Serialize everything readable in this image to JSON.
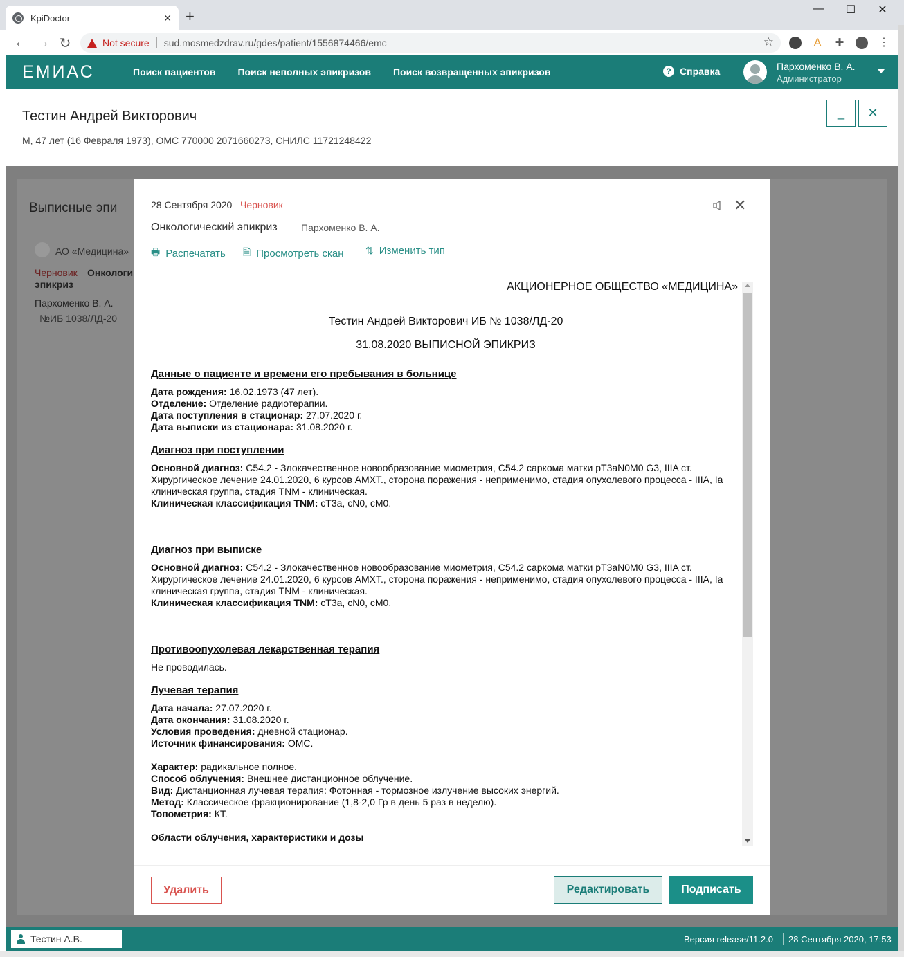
{
  "browser": {
    "tab_title": "KpiDoctor",
    "security_label": "Not secure",
    "url": "sud.mosmedzdrav.ru/gdes/patient/1556874466/emc"
  },
  "app": {
    "logo": "ЕМИАС",
    "nav": [
      "Поиск пациентов",
      "Поиск неполных эпикризов",
      "Поиск возвращенных эпикризов"
    ],
    "help_label": "Справка",
    "user_name": "Пархоменко В. А.",
    "user_role": "Администратор"
  },
  "patient": {
    "name": "Тестин Андрей Викторович",
    "info": "М, 47 лет (16 Февраля 1973), ОМС 770000 2071660273, СНИЛС 11721248422",
    "minimize_label": "_",
    "close_label": "✕"
  },
  "background": {
    "title": "Выписные эпи",
    "org": "АО «Медицина»",
    "draft": "Черновик",
    "doctype_a": "Онкологи",
    "doctype_b": "эпикриз",
    "doctor": "Пархоменко В. А.",
    "ib": "№ИБ 1038/ЛД-20"
  },
  "modal": {
    "date": "28 Сентября 2020",
    "status": "Черновик",
    "type": "Онкологический эпикриз",
    "author": "Пархоменко В. А.",
    "actions": {
      "print": "Распечатать",
      "scan": "Просмотреть скан",
      "change": "Изменить тип"
    },
    "buttons": {
      "delete": "Удалить",
      "edit": "Редактировать",
      "sign": "Подписать"
    }
  },
  "document": {
    "org": "АКЦИОНЕРНОЕ ОБЩЕСТВО «МЕДИЦИНА»",
    "patient_line": "Тестин Андрей Викторович ИБ № 1038/ЛД-20",
    "doc_title": "31.08.2020 ВЫПИСНОЙ ЭПИКРИЗ",
    "s1": {
      "heading": "Данные о пациенте и времени его пребывания в больнице",
      "birth_label": "Дата рождения:",
      "birth": " 16.02.1973 (47 лет).",
      "dept_label": "Отделение:",
      "dept": " Отделение радиотерапии.",
      "in_label": "Дата поступления в стационар:",
      "in": " 27.07.2020 г.",
      "out_label": "Дата выписки из стационара:",
      "out": " 31.08.2020 г."
    },
    "s2": {
      "heading": "Диагноз при поступлении",
      "main_label": "Основной диагноз:",
      "main": " С54.2 - Злокачественное новообразование миометрия, С54.2 саркома матки pT3aN0M0 G3, IIIA ст. Хирургическое лечение 24.01.2020, 6 курсов АМХТ., сторона поражения - неприменимо, стадия опухолевого процесса - IIIA, Ia клиническая группа, стадия TNM - клиническая.",
      "tnm_label": "Клиническая классификация TNM:",
      "tnm": " cT3a, cN0, cM0."
    },
    "s3": {
      "heading": "Диагноз при выписке",
      "main_label": "Основной диагноз:",
      "main": " С54.2 - Злокачественное новообразование миометрия, С54.2 саркома матки pT3aN0M0 G3, IIIA ст. Хирургическое лечение 24.01.2020, 6 курсов АМХТ., сторона поражения - неприменимо, стадия опухолевого процесса - IIIA, Ia клиническая группа, стадия TNM - клиническая.",
      "tnm_label": "Клиническая классификация TNM:",
      "tnm": " cT3a, cN0, cM0."
    },
    "s4": {
      "heading": "Противоопухолевая лекарственная терапия",
      "text": "Не проводилась."
    },
    "s5": {
      "heading": "Лучевая терапия",
      "start_label": "Дата начала:",
      "start": " 27.07.2020 г.",
      "end_label": "Дата окончания:",
      "end": " 31.08.2020 г.",
      "cond_label": "Условия проведения:",
      "cond": " дневной стационар.",
      "fin_label": "Источник финансирования:",
      "fin": " ОМС.",
      "char_label": "Характер:",
      "char": " радикальное полное.",
      "method_label": "Способ облучения:",
      "method": " Внешнее дистанционное облучение.",
      "kind_label": "Вид:",
      "kind": " Дистанционная лучевая терапия: Фотонная - тормозное излучение высоких энергий.",
      "meth_label": "Метод:",
      "meth": " Классическое фракционирование (1,8-2,0 Гр в день 5 раз в неделю).",
      "topo_label": "Топометрия:",
      "topo": " КТ.",
      "areas_heading": "Области облучения, характеристики и дозы"
    }
  },
  "statusbar": {
    "patient": "Тестин А.В.",
    "version": "Версия release/11.2.0",
    "datetime": "28 Сентября 2020, 17:53"
  }
}
